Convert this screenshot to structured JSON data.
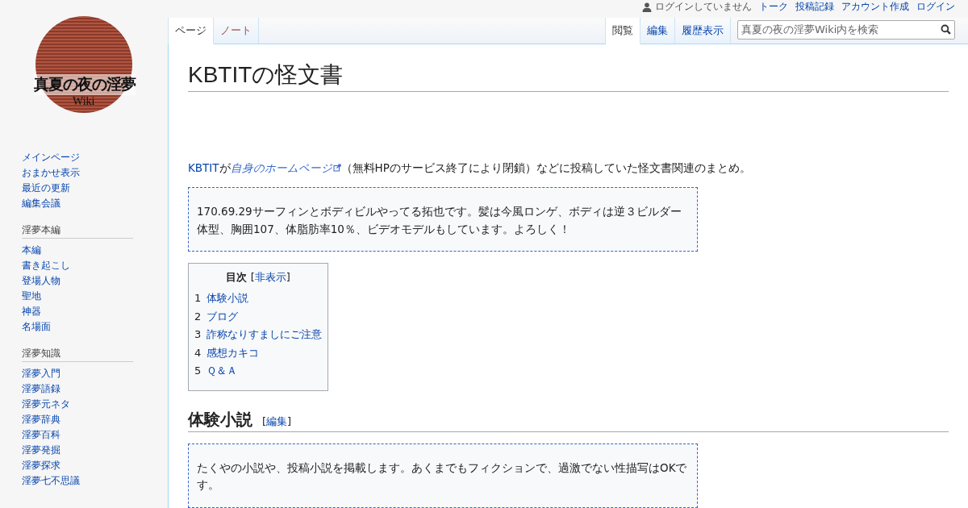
{
  "logo": {
    "title": "真夏の夜の淫夢",
    "subtitle": "Wiki"
  },
  "user_bar": {
    "status": "ログインしていません",
    "links": [
      "トーク",
      "投稿記録",
      "アカウント作成",
      "ログイン"
    ]
  },
  "left_tabs": [
    {
      "label": "ページ",
      "selected": true,
      "new_page": false
    },
    {
      "label": "ノート",
      "selected": false,
      "new_page": true
    }
  ],
  "right_tabs": [
    {
      "label": "閲覧",
      "selected": true
    },
    {
      "label": "編集",
      "selected": false
    },
    {
      "label": "履歴表示",
      "selected": false
    }
  ],
  "search": {
    "placeholder": "真夏の夜の淫夢Wiki内を検索"
  },
  "sidebar": {
    "items": [
      "メインページ",
      "おまかせ表示",
      "最近の更新",
      "編集会議"
    ],
    "sections": [
      {
        "heading": "淫夢本編",
        "items": [
          "本編",
          "書き起こし",
          "登場人物",
          "聖地",
          "神器",
          "名場面"
        ]
      },
      {
        "heading": "淫夢知識",
        "items": [
          "淫夢入門",
          "淫夢語録",
          "淫夢元ネタ",
          "淫夢辞典",
          "淫夢百科",
          "淫夢発掘",
          "淫夢探求",
          "淫夢七不思議"
        ]
      }
    ]
  },
  "page": {
    "title": "KBTITの怪文書",
    "intro": {
      "link": "KBTIT",
      "text_1": "が",
      "external_link": "自身のホームページ",
      "text_2": "（無料HPのサービス終了により閉鎖）などに投稿していた怪文書関連のまとめ。"
    },
    "quote": "170.69.29サーフィンとボディビルやってる拓也です。髪は今風ロンゲ、ボディは逆３ビルダー体型、胸囲107、体脂肪率10％、ビデオモデルもしています。よろしく！",
    "toc": {
      "title": "目次",
      "toggle_open": "[",
      "toggle": "非表示",
      "toggle_close": "]",
      "items": [
        {
          "number": "1",
          "label": "体験小説"
        },
        {
          "number": "2",
          "label": "ブログ"
        },
        {
          "number": "3",
          "label": "詐称なりすましにご注意"
        },
        {
          "number": "4",
          "label": "感想カキコ"
        },
        {
          "number": "5",
          "label": "Ｑ＆Ａ"
        }
      ]
    },
    "sections": [
      {
        "heading": "体験小説",
        "edit_open": "[",
        "edit": "編集",
        "edit_close": "]",
        "quote": "たくやの小説や、投稿小説を掲載します。あくまでもフィクションで、過激でない性描写はOKです。"
      }
    ]
  }
}
